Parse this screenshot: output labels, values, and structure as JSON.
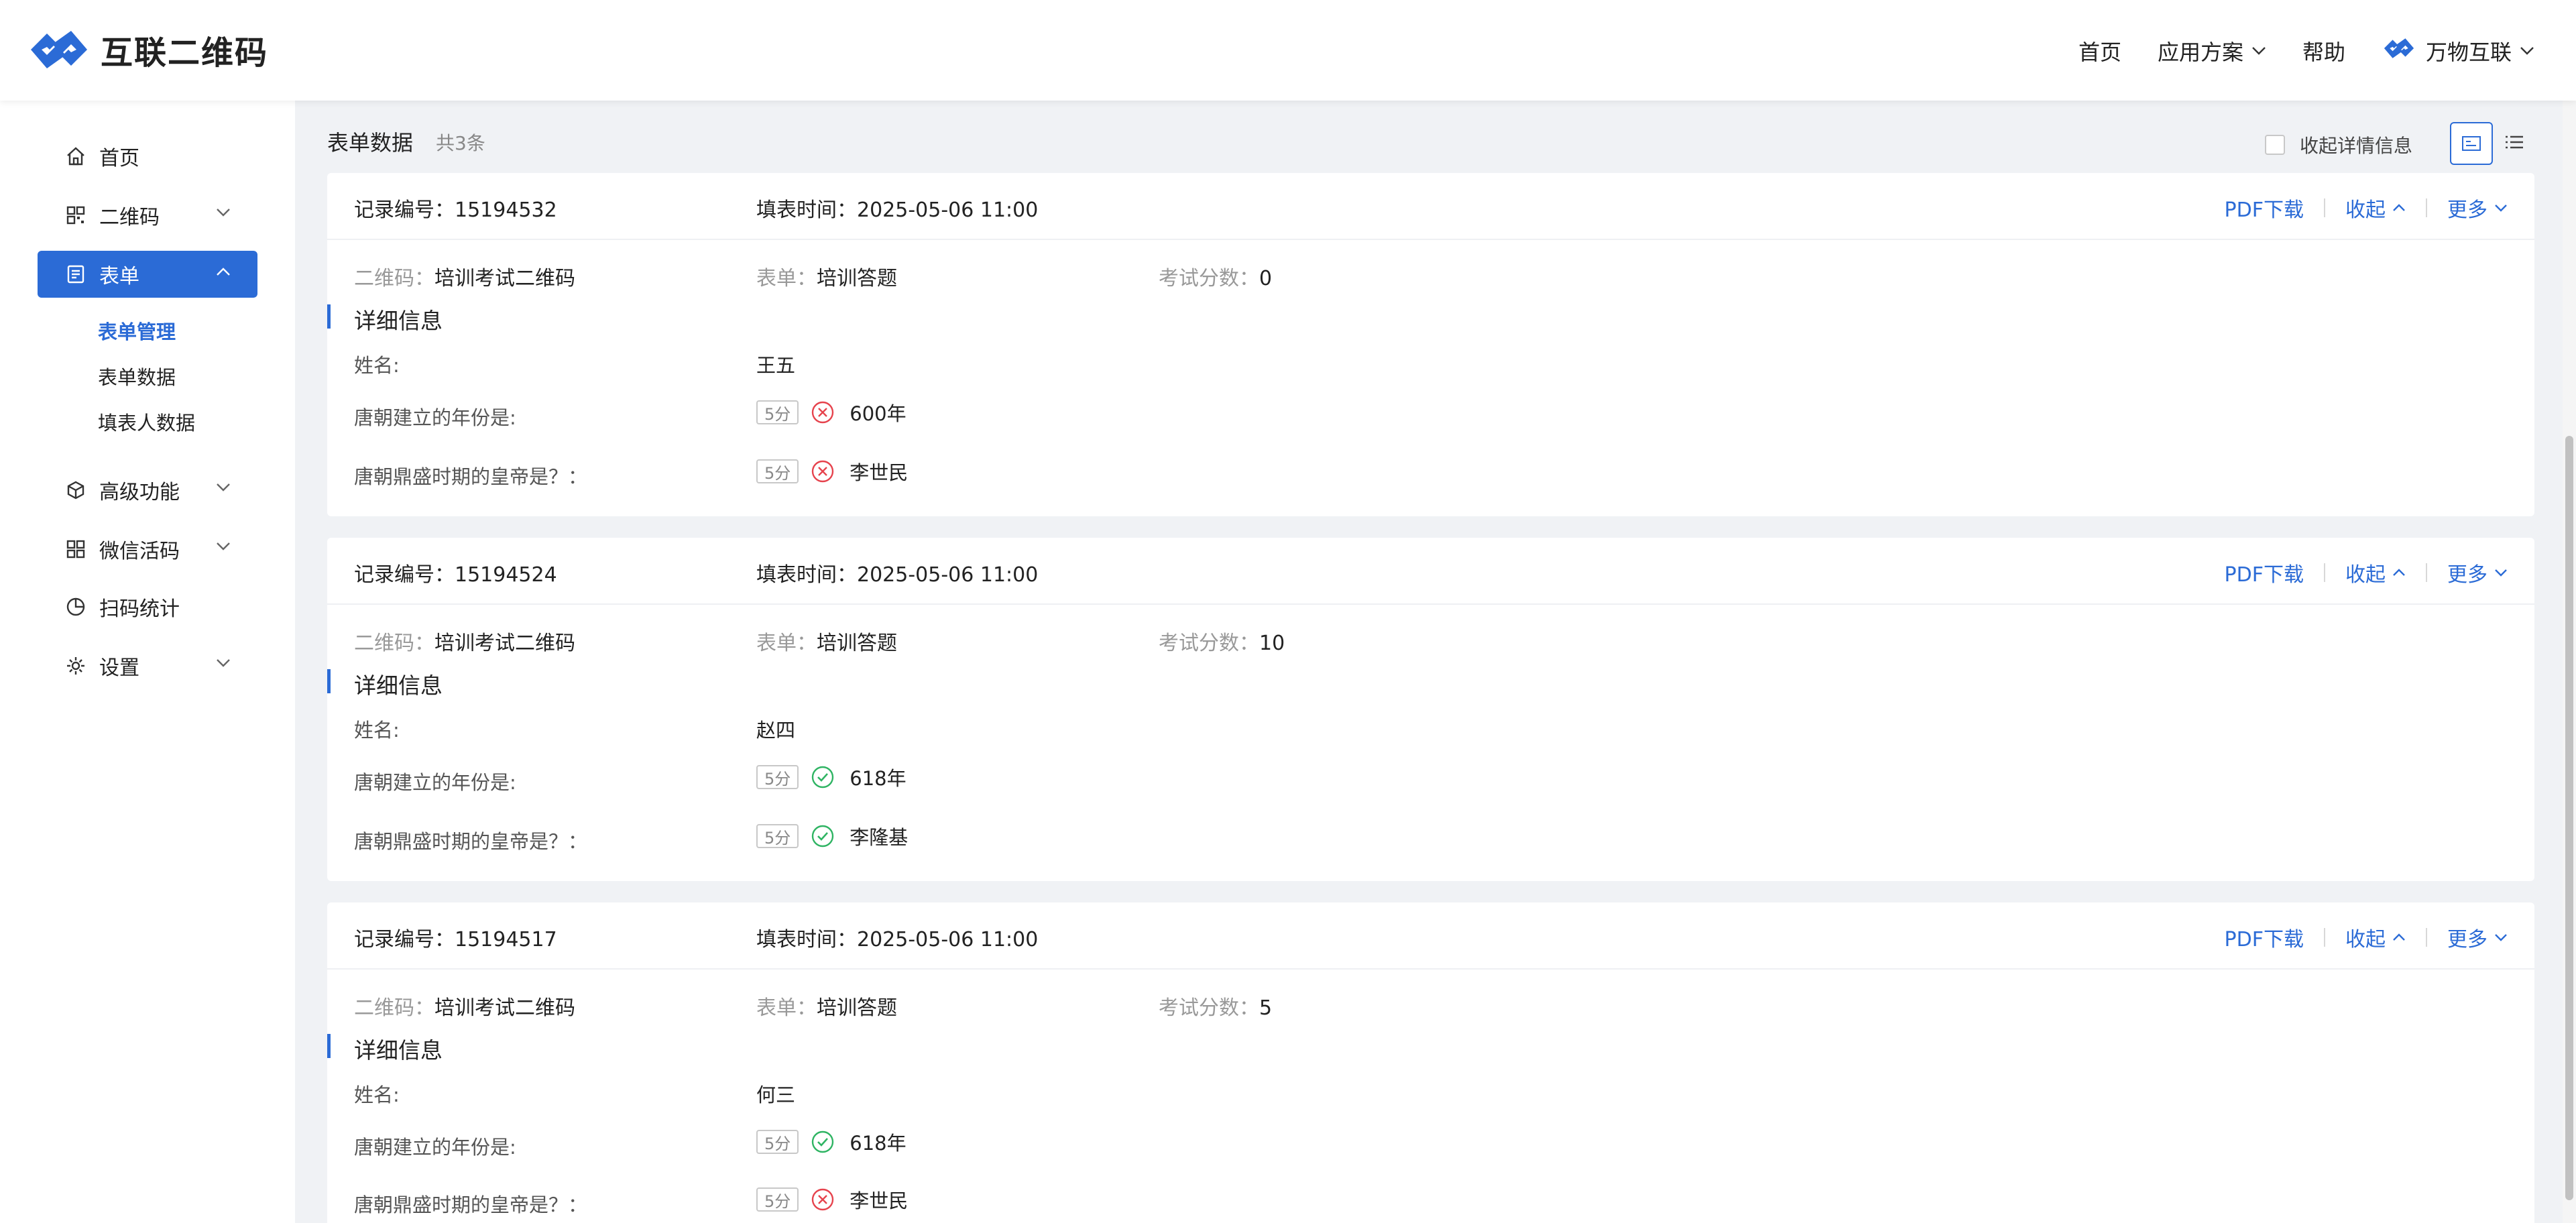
{
  "header": {
    "logo_text": "互联二维码",
    "nav": [
      {
        "label": "首页"
      },
      {
        "label": "应用方案"
      },
      {
        "label": "帮助"
      },
      {
        "label": "万物互联"
      }
    ]
  },
  "sidebar": {
    "items": [
      {
        "label": "首页"
      },
      {
        "label": "二维码"
      },
      {
        "label": "表单"
      },
      {
        "label": "高级功能"
      },
      {
        "label": "微信活码"
      },
      {
        "label": "扫码统计"
      },
      {
        "label": "设置"
      }
    ],
    "subitems": [
      {
        "label": "表单管理"
      },
      {
        "label": "表单数据"
      },
      {
        "label": "填表人数据"
      }
    ]
  },
  "page": {
    "title": "表单数据",
    "count": "共3条",
    "collapse_label": "收起详情信息"
  },
  "labels": {
    "record_id": "记录编号：",
    "fill_time": "填表时间：",
    "qrcode": "二维码：",
    "form": "表单：",
    "score": "考试分数：",
    "detail": "详细信息",
    "name": "姓名:",
    "q1": "唐朝建立的年份是:",
    "q2": "唐朝鼎盛时期的皇帝是？：",
    "pdf": "PDF下载",
    "collapse": "收起",
    "more": "更多",
    "score_tag": "5分"
  },
  "records": [
    {
      "id": "15194532",
      "time": "2025-05-06 11:00",
      "qrcode": "培训考试二维码",
      "form": "培训答题",
      "score": "0",
      "name": "王五",
      "q1": {
        "answer": "600年",
        "correct": false
      },
      "q2": {
        "answer": "李世民",
        "correct": false
      }
    },
    {
      "id": "15194524",
      "time": "2025-05-06 11:00",
      "qrcode": "培训考试二维码",
      "form": "培训答题",
      "score": "10",
      "name": "赵四",
      "q1": {
        "answer": "618年",
        "correct": true
      },
      "q2": {
        "answer": "李隆基",
        "correct": true
      }
    },
    {
      "id": "15194517",
      "time": "2025-05-06 11:00",
      "qrcode": "培训考试二维码",
      "form": "培训答题",
      "score": "5",
      "name": "何三",
      "q1": {
        "answer": "618年",
        "correct": true
      },
      "q2": {
        "answer": "李世民",
        "correct": false
      }
    }
  ],
  "colors": {
    "accent": "#2b6bd6",
    "correct": "#2fb463",
    "wrong": "#e6434d"
  }
}
